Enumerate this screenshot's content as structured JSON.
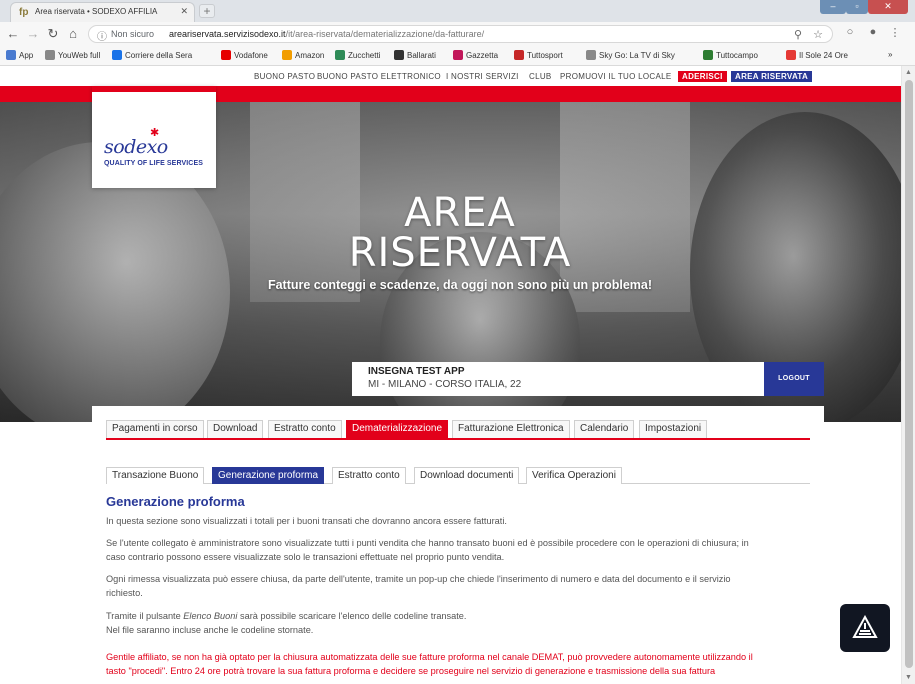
{
  "browser": {
    "tab_title": "Area riservata • SODEXO AFFILIA",
    "tab_favicon": "fp",
    "url_security": "Non sicuro",
    "url_host": "areariservata.servizisodexo.it",
    "url_path": "/it/area-riservata/dematerializzazione/da-fatturare/",
    "bookmarks": [
      {
        "label": "App",
        "icon": "apps-grid-icon",
        "color": "#4a7bd0"
      },
      {
        "label": "YouWeb full",
        "icon": "page-icon",
        "color": "#888888"
      },
      {
        "label": "Corriere della Sera",
        "icon": "corriere-icon",
        "color": "#1a73e8"
      },
      {
        "label": "Vodafone",
        "icon": "vodafone-icon",
        "color": "#e60000"
      },
      {
        "label": "Amazon",
        "icon": "amazon-icon",
        "color": "#f29d00"
      },
      {
        "label": "Zucchetti",
        "icon": "zucchetti-icon",
        "color": "#2e8b57"
      },
      {
        "label": "Ballarati",
        "icon": "ballarati-icon",
        "color": "#333333"
      },
      {
        "label": "Gazzetta",
        "icon": "gazzetta-icon",
        "color": "#c2185b"
      },
      {
        "label": "Tuttosport",
        "icon": "tuttosport-icon",
        "color": "#c62828"
      },
      {
        "label": "Sky Go: La TV di Sky",
        "icon": "page-icon",
        "color": "#888888"
      },
      {
        "label": "Tuttocampo",
        "icon": "tuttocampo-icon",
        "color": "#2e7d32"
      },
      {
        "label": "Il Sole 24 Ore",
        "icon": "sole24-icon",
        "color": "#e53935"
      }
    ],
    "bookmarks_more": "»"
  },
  "topnav": {
    "items": [
      "BUONO PASTO",
      "BUONO PASTO ELETTRONICO",
      "I NOSTRI SERVIZI",
      "CLUB",
      "PROMUOVI IL TUO LOCALE"
    ],
    "aderisci": "ADERISCI",
    "area_riservata": "AREA RISERVATA"
  },
  "logo": {
    "word": "sodexo",
    "tagline": "QUALITY OF LIFE SERVICES"
  },
  "hero": {
    "title_line1": "AREA",
    "title_line2": "RISERVATA",
    "subtitle": "Fatture conteggi e scadenze, da oggi non sono più un problema!"
  },
  "shop": {
    "name": "INSEGNA TEST APP",
    "address": "MI - MILANO - CORSO ITALIA, 22",
    "logout_label": "LOGOUT"
  },
  "main_tabs": [
    "Pagamenti in corso",
    "Download",
    "Estratto conto",
    "Dematerializzazione",
    "Fatturazione Elettronica",
    "Calendario",
    "Impostazioni"
  ],
  "main_tab_active": "Dematerializzazione",
  "sub_tabs": [
    "Transazione Buono",
    "Generazione proforma",
    "Estratto conto",
    "Download documenti",
    "Verifica Operazioni"
  ],
  "sub_tab_active": "Generazione proforma",
  "section": {
    "title": "Generazione proforma",
    "p1": "In questa sezione sono visualizzati i totali per i buoni transati che dovranno ancora essere fatturati.",
    "p2a": "Se l'utente collegato è amministratore sono visualizzate tutti i punti vendita che hanno transato buoni ed è possibile procedere con le operazioni di chiusura; in",
    "p2b": "caso contrario possono essere visualizzate solo le transazioni effettuate nel proprio punto vendita.",
    "p3a": "Ogni rimessa visualizzata può essere chiusa, da parte dell'utente, tramite un pop-up che chiede l'inserimento di numero e data del documento e il servizio",
    "p3b": "richiesto.",
    "p4_pre": "Tramite il pulsante ",
    "p4_em": "Elenco Buoni",
    "p4_post": " sarà possibile scaricare l'elenco delle codeline transate.",
    "p5": "Nel file saranno incluse anche le codeline stornate.",
    "p6a": "Gentile affiliato, se non ha già optato per la chiusura automatizzata delle sue fatture proforma nel canale DEMAT, può provvedere autonomamente utilizzando il",
    "p6b": "tasto \"procedi\". Entro 24 ore potrà trovare la sua fattura proforma e decidere se proseguire nel servizio di generazione e trasmissione della sua fattura"
  },
  "colors": {
    "brand_red": "#e2001a",
    "brand_navy": "#283897"
  }
}
